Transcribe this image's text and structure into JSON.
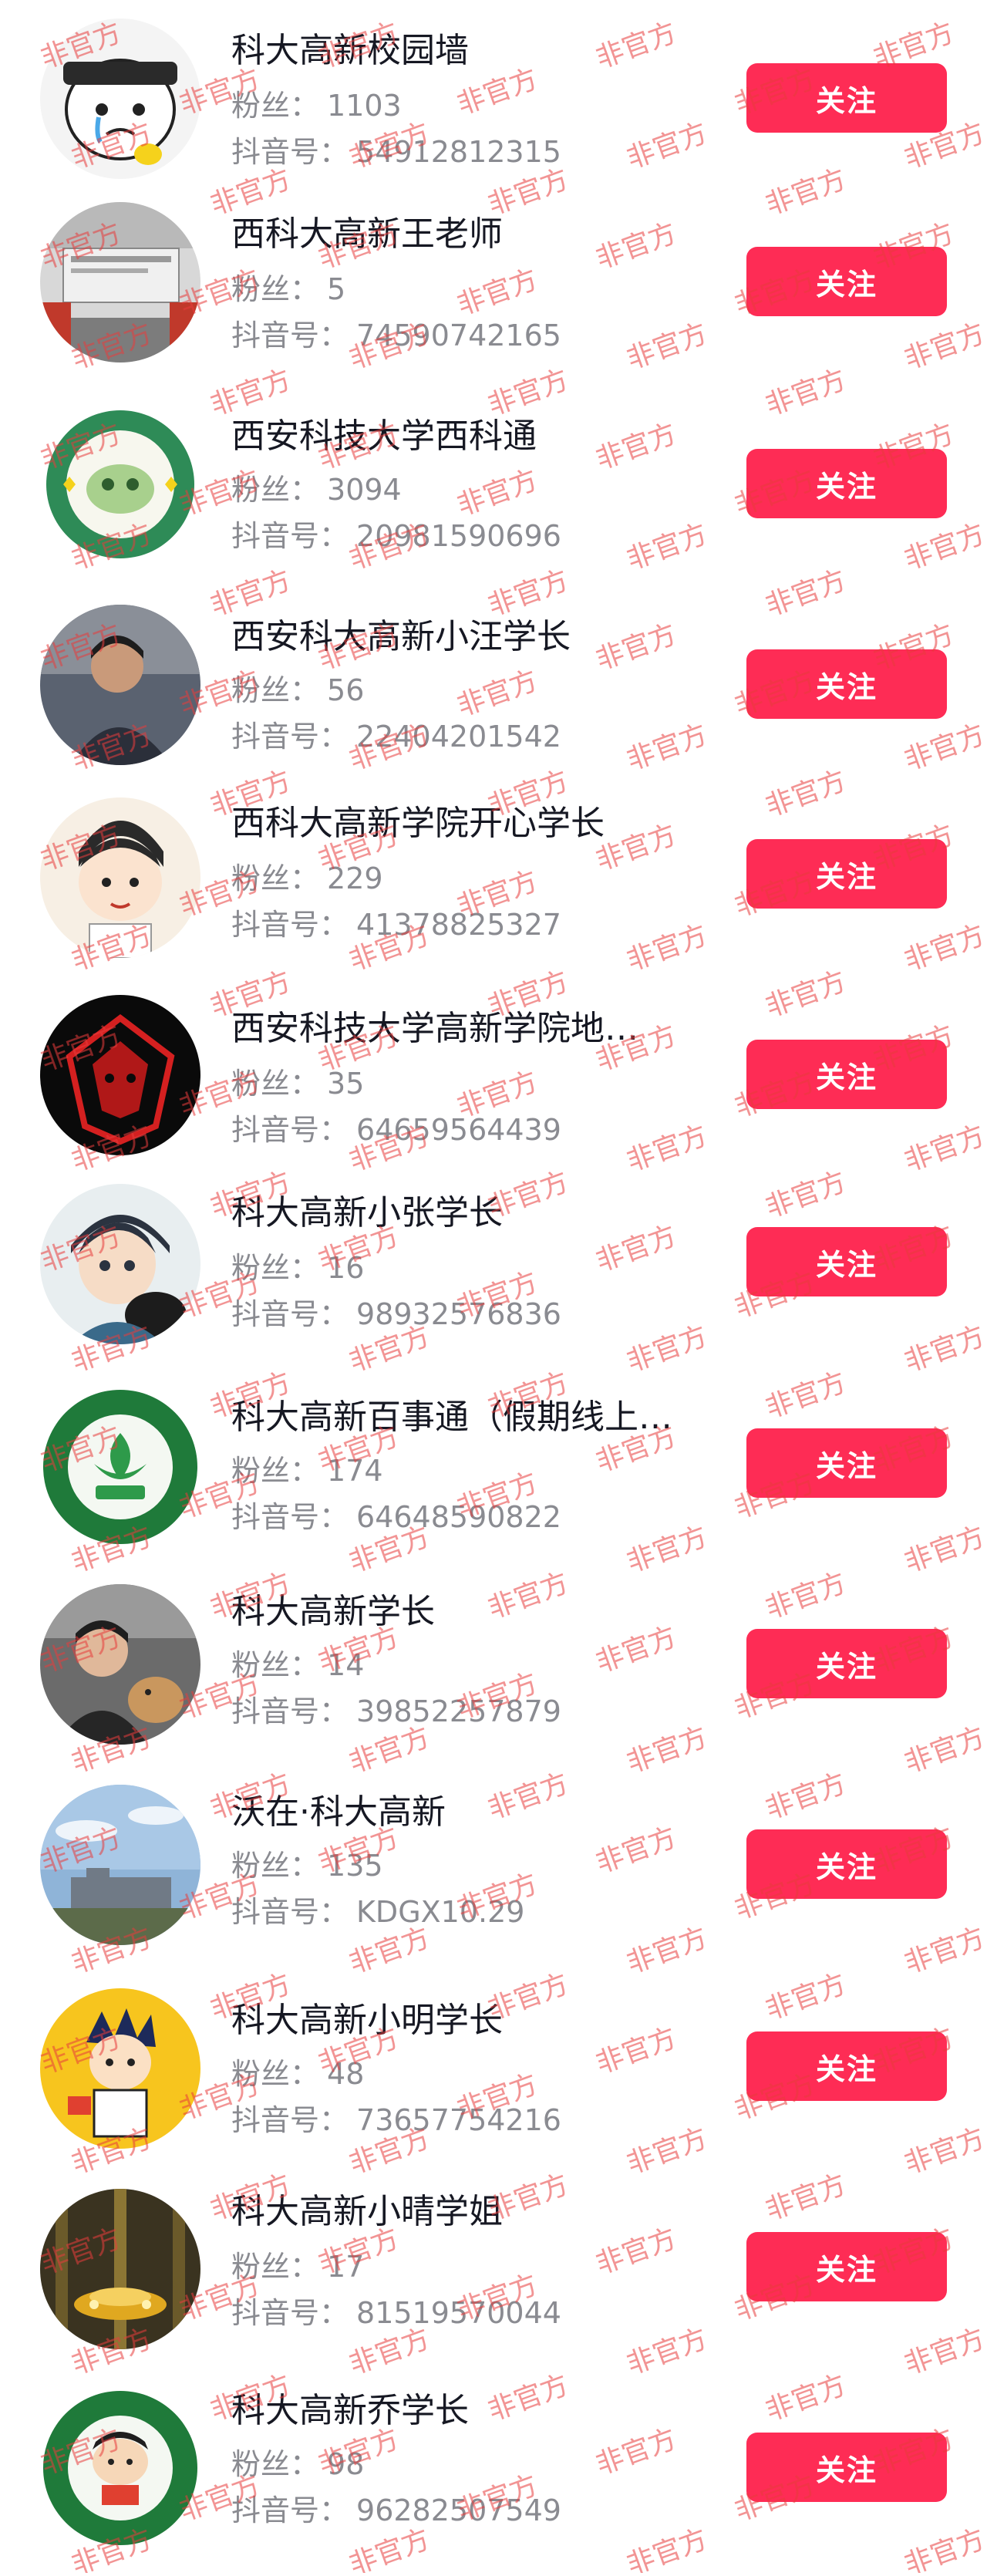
{
  "labels": {
    "fans": "粉丝：",
    "douyin_id": "抖音号：",
    "follow_button": "关注"
  },
  "watermark_text": "非官方",
  "colors": {
    "follow_button_bg": "#fe2c55",
    "watermark": "#e83c3c",
    "name_text": "#161823",
    "meta_text": "#8a8b91"
  },
  "accounts": [
    {
      "name": "科大高新校园墙",
      "fans": "1103",
      "douyin_id": "54912812315",
      "avatar": "cartoon-crying-face-avatar"
    },
    {
      "name": "西科大高新王老师",
      "fans": "5",
      "douyin_id": "74590742165",
      "avatar": "building-sign-avatar"
    },
    {
      "name": "西安科技大学西科通",
      "fans": "3094",
      "douyin_id": "20981590696",
      "avatar": "xiketong-green-badge-avatar"
    },
    {
      "name": "西安科大高新小汪学长",
      "fans": "56",
      "douyin_id": "22404201542",
      "avatar": "person-photo-avatar"
    },
    {
      "name": "西科大高新学院开心学长",
      "fans": "229",
      "douyin_id": "41378825327",
      "avatar": "cartoon-boy-avatar"
    },
    {
      "name": "西安科技大学高新学院地…",
      "fans": "35",
      "douyin_id": "64659564439",
      "avatar": "red-wolf-emblem-avatar"
    },
    {
      "name": "科大高新小张学长",
      "fans": "16",
      "douyin_id": "98932576836",
      "avatar": "anime-boy-cat-avatar"
    },
    {
      "name": "科大高新百事通（假期线上…",
      "fans": "174",
      "douyin_id": "64648590822",
      "avatar": "university-green-seal-avatar"
    },
    {
      "name": "科大高新学长",
      "fans": "14",
      "douyin_id": "39852257879",
      "avatar": "person-with-dog-avatar"
    },
    {
      "name": "沃在·科大高新",
      "fans": "135",
      "douyin_id": "KDGX10.29",
      "avatar": "campus-sky-avatar"
    },
    {
      "name": "科大高新小明学长",
      "fans": "48",
      "douyin_id": "73657754216",
      "avatar": "cartoon-yellow-avatar"
    },
    {
      "name": "科大高新小晴学姐",
      "fans": "17",
      "douyin_id": "81519570044",
      "avatar": "golden-chandelier-avatar"
    },
    {
      "name": "科大高新乔学长",
      "fans": "98",
      "douyin_id": "96282507549",
      "avatar": "university-seal-cartoon-avatar"
    }
  ]
}
